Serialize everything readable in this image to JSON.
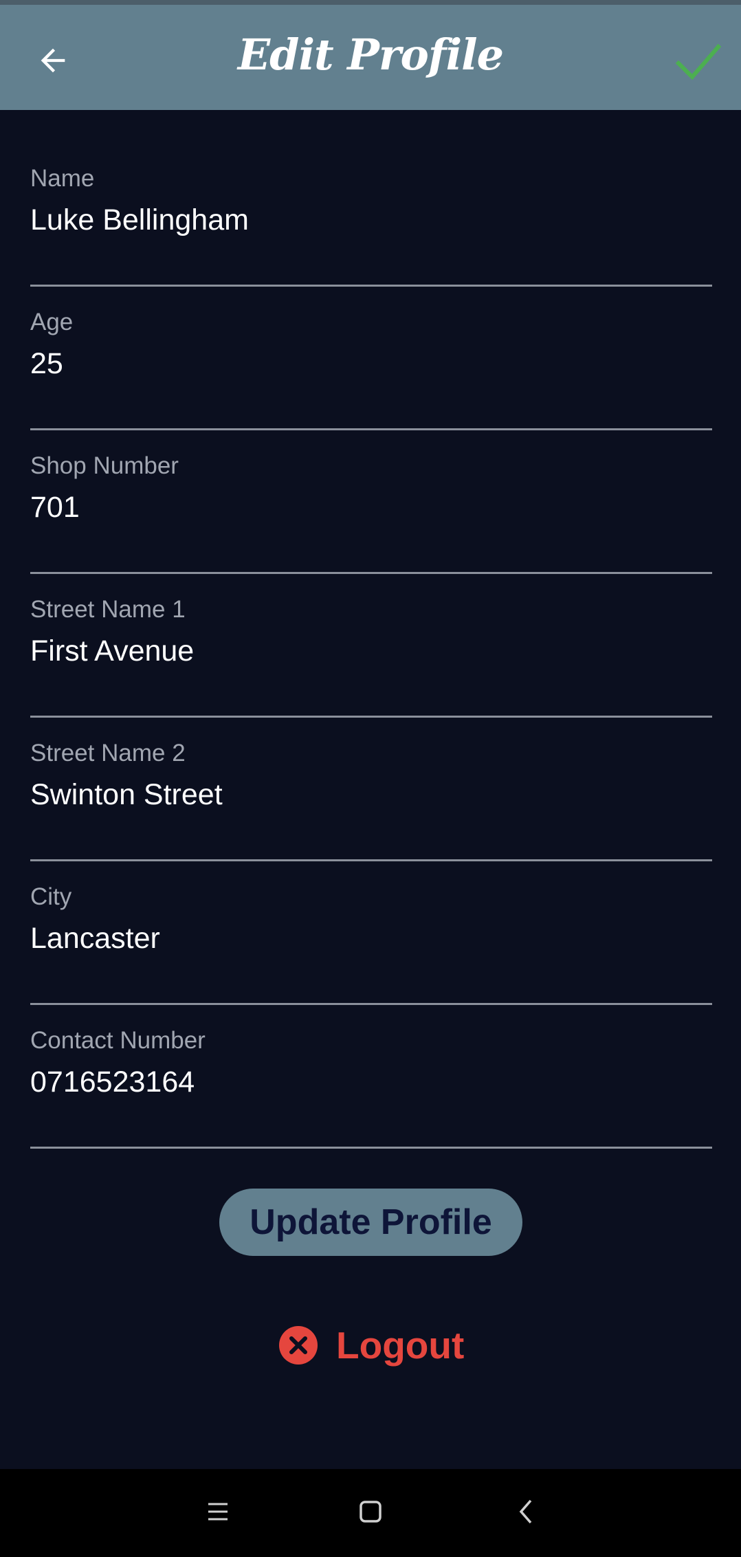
{
  "header": {
    "title": "Edit Profile",
    "back_icon": "arrow-left-icon",
    "confirm_icon": "checkmark-icon",
    "background_color": "#62808f",
    "confirm_color": "#4caf50"
  },
  "form": {
    "fields": [
      {
        "label": "Name",
        "value": "Luke Bellingham"
      },
      {
        "label": "Age",
        "value": "25"
      },
      {
        "label": "Shop Number",
        "value": "701"
      },
      {
        "label": "Street Name 1",
        "value": "First Avenue"
      },
      {
        "label": "Street Name 2",
        "value": "Swinton Street"
      },
      {
        "label": "City",
        "value": "Lancaster"
      },
      {
        "label": "Contact Number",
        "value": "0716523164"
      }
    ]
  },
  "actions": {
    "update_label": "Update Profile",
    "logout_label": "Logout",
    "logout_icon": "close-circle-icon",
    "logout_color": "#e5463e"
  },
  "system_nav": {
    "items": [
      "menu-icon",
      "home-square-icon",
      "back-chevron-icon"
    ]
  }
}
